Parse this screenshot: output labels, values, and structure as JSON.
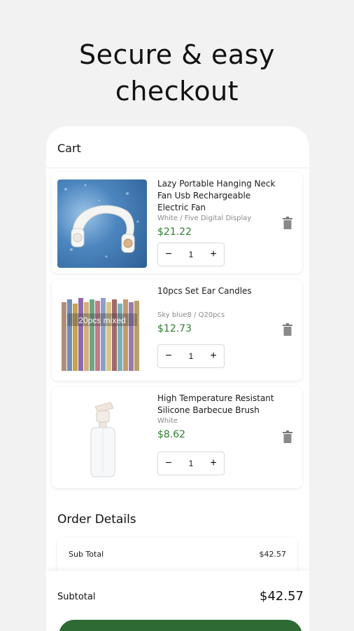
{
  "headline": {
    "line1": "Secure & easy",
    "line2": "checkout"
  },
  "cart": {
    "title": "Cart",
    "items": [
      {
        "name": "Lazy Portable Hanging Neck Fan Usb Rechargeable Electric Fan",
        "variant": "White / Five Digital Display",
        "price": "$21.22",
        "quantity": "1",
        "image": "neck-fan-image"
      },
      {
        "name": "10pcs Set Ear Candles",
        "variant": "Sky blue8 / Q20pcs",
        "price": "$12.73",
        "quantity": "1",
        "image": "ear-candles-image",
        "image_caption": "20pcs mixed"
      },
      {
        "name": "High Temperature Resistant Silicone Barbecue Brush",
        "variant": "White",
        "price": "$8.62",
        "quantity": "1",
        "image": "bbq-brush-bottle-image"
      }
    ],
    "qty_minus": "−",
    "qty_plus": "+"
  },
  "order_details": {
    "title": "Order Details",
    "rows": [
      {
        "label": "Sub Total",
        "value": "$42.57"
      }
    ]
  },
  "footer": {
    "label": "Subtotal",
    "total": "$42.57"
  },
  "colors": {
    "accent_green": "#2e6b34",
    "price_green": "#2e7d32",
    "background": "#f2f2f2"
  }
}
